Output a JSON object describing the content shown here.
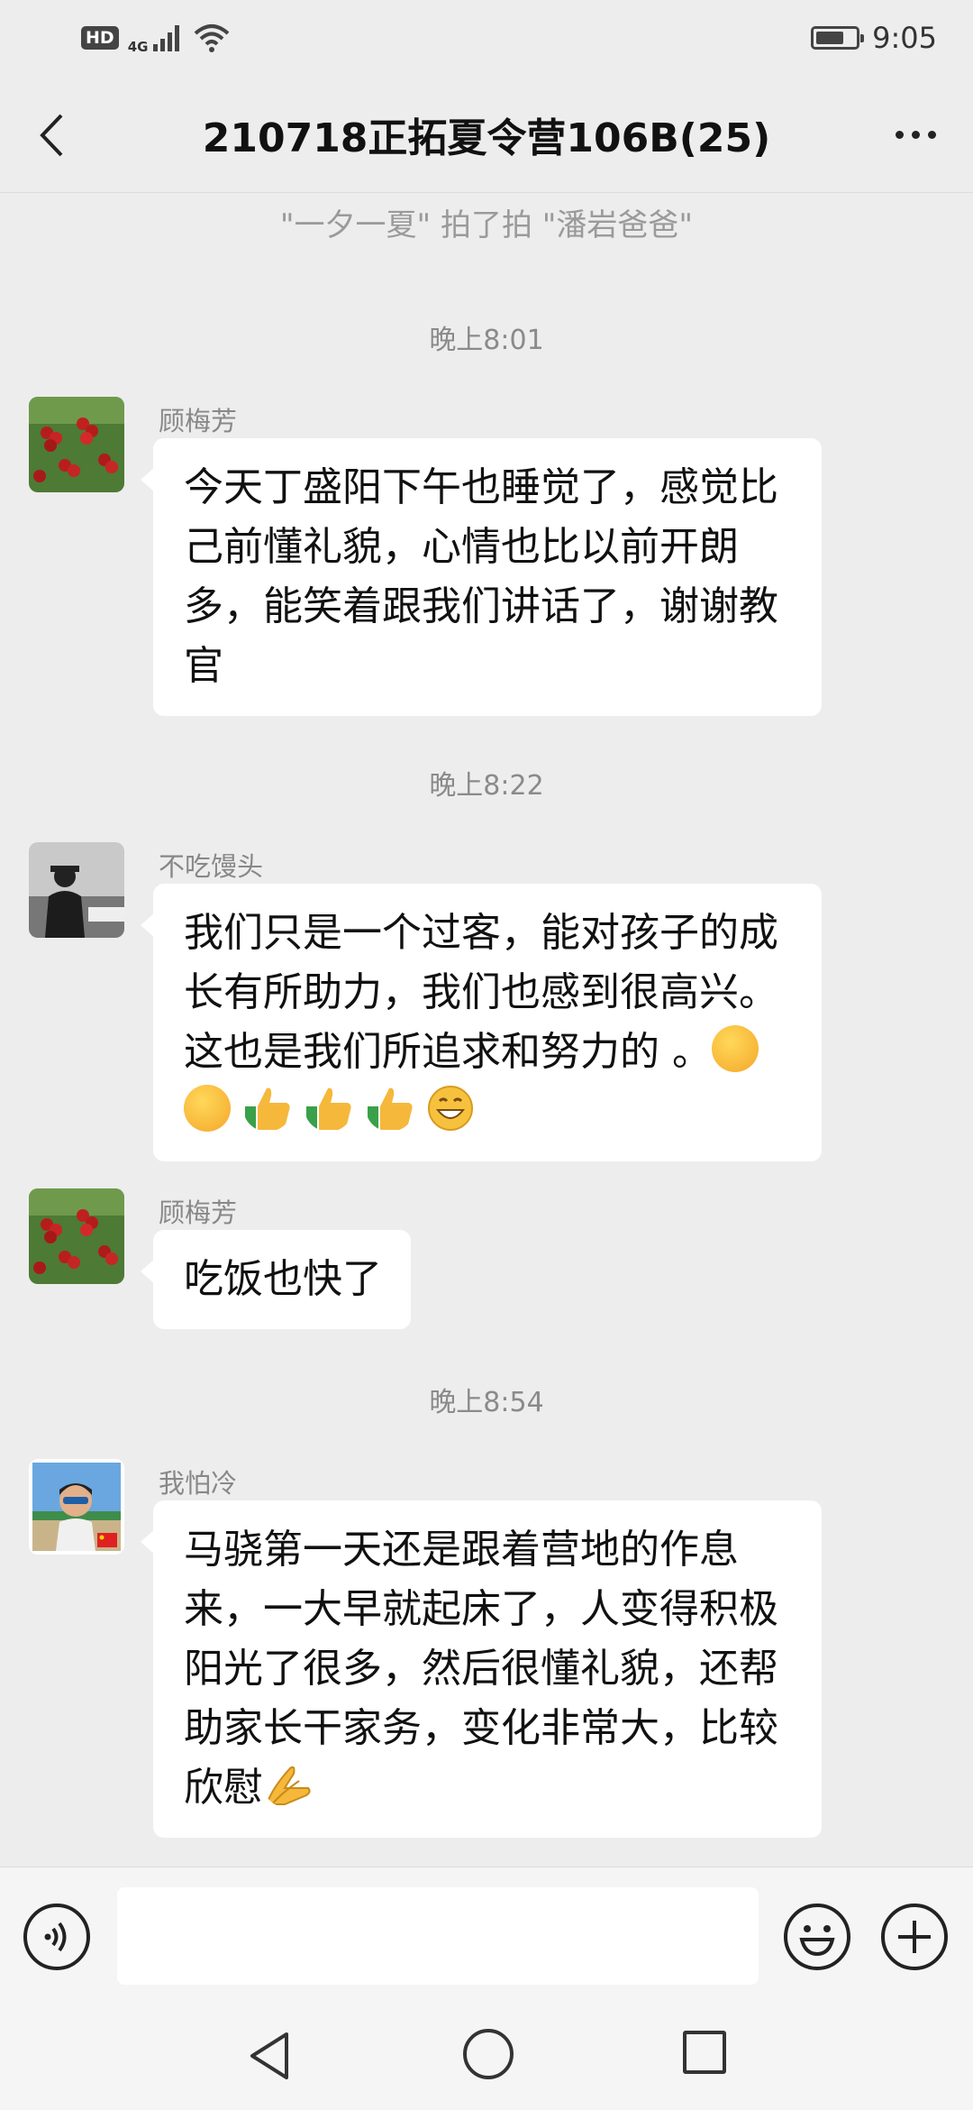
{
  "status_bar": {
    "hd": "HD",
    "network": "4G",
    "time": "9:05",
    "battery_level": 0.7
  },
  "header": {
    "title": "210718正拓夏令营106B(25)"
  },
  "system_message": "\"一夕一夏\" 拍了拍 \"潘岩爸爸\"",
  "timestamps": [
    "晚上8:01",
    "晚上8:22",
    "晚上8:54"
  ],
  "messages": [
    {
      "sender": "顾梅芳",
      "avatar": "berries-avatar",
      "text": "今天丁盛阳下午也睡觉了，感觉比己前懂礼貌，心情也比以前开朗多，能笑着跟我们讲话了，谢谢教官"
    },
    {
      "sender": "不吃馒头",
      "avatar": "silhouette-avatar",
      "text": "我们只是一个过客，能对孩子的成长有所助力，我们也感到很高兴。这也是我们所追求和努力的 。",
      "emojis": [
        "thinking-face",
        "thinking-face",
        "thumbs-up",
        "thumbs-up",
        "thumbs-up",
        "grinning-face"
      ]
    },
    {
      "sender": "顾梅芳",
      "avatar": "berries-avatar",
      "text": "吃饭也快了"
    },
    {
      "sender": "我怕冷",
      "avatar": "beach-avatar",
      "text": "马骁第一天还是跟着营地的作息来，一大早就起床了，人变得积极阳光了很多，然后很懂礼貌，还帮助家长干家务，变化非常大，比较欣慰",
      "emojis": [
        "praying-hands"
      ]
    }
  ],
  "input": {
    "placeholder": ""
  },
  "colors": {
    "background": "#ededed",
    "bubble": "#ffffff",
    "timestamp": "#8a8a8a"
  }
}
